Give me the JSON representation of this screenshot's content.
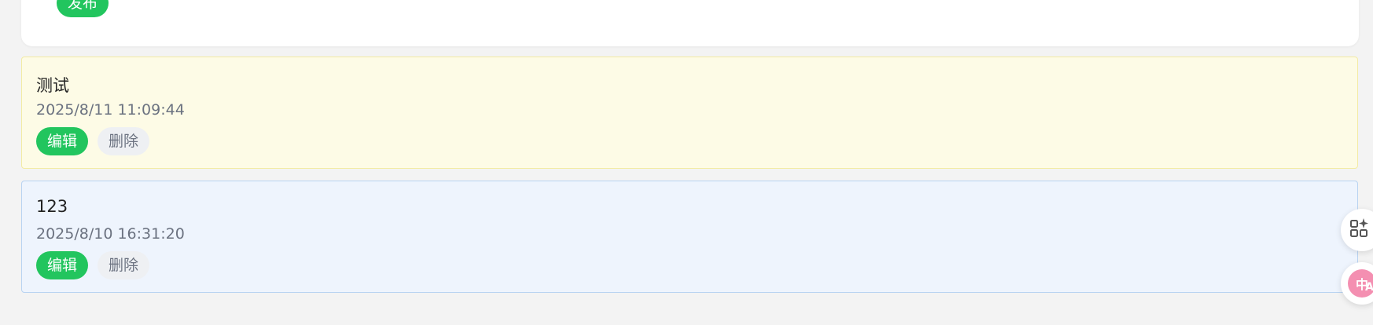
{
  "composer": {
    "publish_label": "发布"
  },
  "notes": [
    {
      "title": "测试",
      "time": "2025/8/11 11:09:44",
      "edit_label": "编辑",
      "delete_label": "删除"
    },
    {
      "title": "123",
      "time": "2025/8/10 16:31:20",
      "edit_label": "编辑",
      "delete_label": "删除"
    }
  ],
  "floating_actions": {
    "apps_icon": "apps-sparkle-icon",
    "translate_icon": "translate-icon"
  },
  "colors": {
    "accent": "#22c55e",
    "note_yellow_bg": "#fdfbe6",
    "note_blue_bg": "#eef4fd",
    "translate_pink": "#f06292"
  }
}
